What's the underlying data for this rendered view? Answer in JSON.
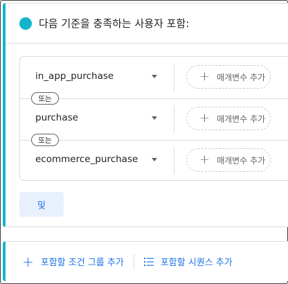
{
  "header": {
    "title": "다음 기준을 충족하는 사용자 포함:"
  },
  "conditions": [
    {
      "event": "in_app_purchase",
      "add_param_label": "매개변수 추가"
    },
    {
      "event": "purchase",
      "add_param_label": "매개변수 추가"
    },
    {
      "event": "ecommerce_purchase",
      "add_param_label": "매개변수 추가"
    }
  ],
  "or_label": "또는",
  "and_button": {
    "label": "및"
  },
  "footer": {
    "add_group_label": "포함할 조건 그룹 추가",
    "add_sequence_label": "포함할 시퀀스 추가"
  },
  "colors": {
    "accent": "#12b5cb",
    "link": "#1a73e8",
    "and_bg": "#e8f0fe"
  },
  "icons": [
    "cyan-dot-icon",
    "dropdown-arrow-icon",
    "plus-icon",
    "sequence-list-icon"
  ]
}
